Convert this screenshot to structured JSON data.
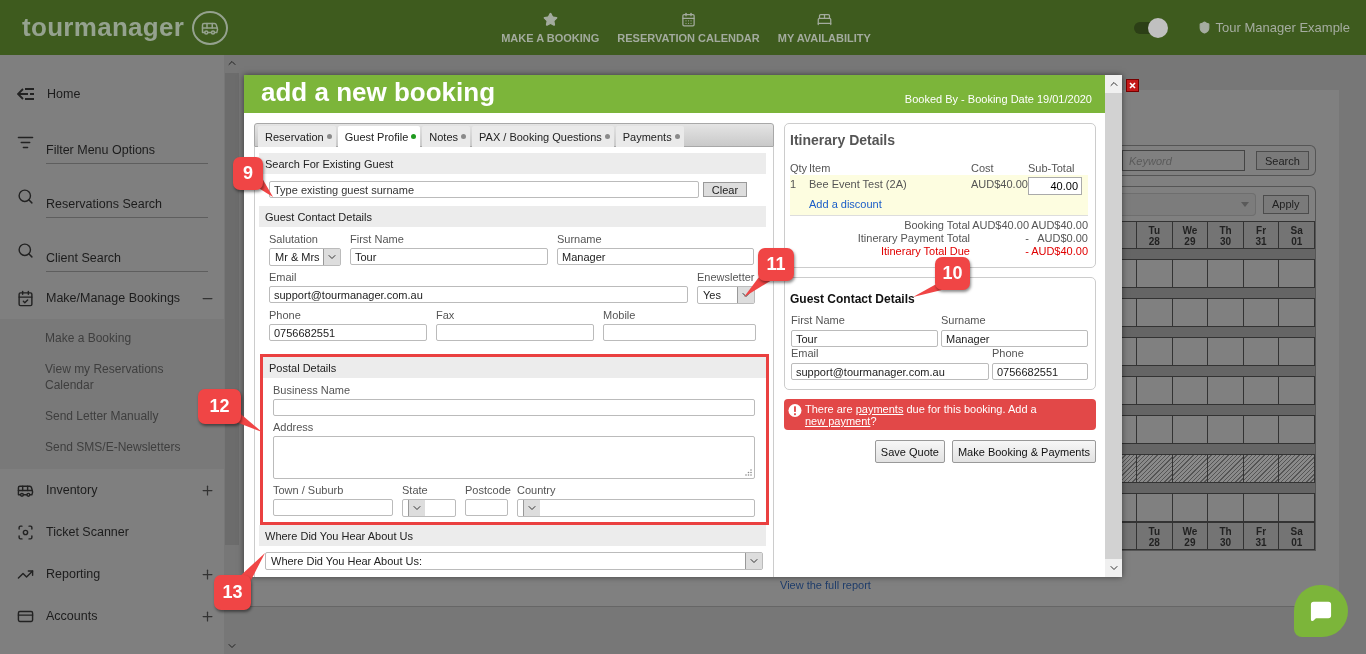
{
  "topbar": {
    "logo": "tourmanager",
    "nav": [
      {
        "label": "MAKE A BOOKING"
      },
      {
        "label": "RESERVATION CALENDAR"
      },
      {
        "label": "MY AVAILABILITY"
      }
    ],
    "toggle": {
      "on": true
    },
    "account": "Tour Manager Example"
  },
  "sidebar": {
    "items": [
      {
        "label": "Home",
        "kind": "link"
      },
      {
        "label": "Filter Menu Options",
        "kind": "field"
      },
      {
        "label": "Reservations Search",
        "kind": "field"
      },
      {
        "label": "Client Search",
        "kind": "field"
      },
      {
        "label": "Make/Manage Bookings",
        "kind": "link",
        "expanded": true,
        "children": [
          {
            "label": "Make a Booking"
          },
          {
            "label": "View my Reservations Calendar"
          },
          {
            "label": "Send Letter Manually"
          },
          {
            "label": "Send SMS/E-Newsletters"
          }
        ]
      },
      {
        "label": "Inventory",
        "kind": "link",
        "expanded": false
      },
      {
        "label": "Ticket Scanner",
        "kind": "link"
      },
      {
        "label": "Reporting",
        "kind": "link",
        "expanded": false
      },
      {
        "label": "Accounts",
        "kind": "link",
        "expanded": false
      }
    ]
  },
  "background": {
    "search": {
      "placeholder": "Keyword",
      "button": "Search"
    },
    "filter": {
      "button": "Apply"
    },
    "calendar": {
      "days": [
        {
          "day": "Tu",
          "date": "28"
        },
        {
          "day": "We",
          "date": "29"
        },
        {
          "day": "Th",
          "date": "30"
        },
        {
          "day": "Fr",
          "date": "31"
        },
        {
          "day": "Sa",
          "date": "01"
        }
      ],
      "footer_days": [
        {
          "day": "Tu",
          "date": "28"
        },
        {
          "day": "We",
          "date": "29"
        },
        {
          "day": "Th",
          "date": "30"
        },
        {
          "day": "Fr",
          "date": "31"
        },
        {
          "day": "Sa",
          "date": "01"
        }
      ],
      "rows": [
        {
          "hatched": false
        },
        {
          "hatched": false
        },
        {
          "hatched": false
        },
        {
          "hatched": false
        },
        {
          "hatched": false
        },
        {
          "hatched": true
        },
        {
          "hatched": false
        }
      ]
    },
    "report_link": "View the full report"
  },
  "modal": {
    "title": "add a new booking",
    "booked": "Booked By - Booking Date 19/01/2020",
    "tabs": [
      {
        "label": "Reservation",
        "selected": false,
        "color": "#8a8a8a"
      },
      {
        "label": "Guest Profile",
        "selected": true,
        "color": "#1f9a1f"
      },
      {
        "label": "Notes",
        "selected": false,
        "color": "#8a8a8a"
      },
      {
        "label": "PAX / Booking Questions",
        "selected": false,
        "color": "#8a8a8a"
      },
      {
        "label": "Payments",
        "selected": false,
        "color": "#8a8a8a"
      }
    ],
    "guest_search": {
      "heading": "Search For Existing Guest",
      "placeholder": "Type existing guest surname",
      "button": "Clear"
    },
    "contact": {
      "heading": "Guest Contact Details",
      "rows": [
        [
          {
            "label": "Salutation",
            "kind": "select",
            "value": "Mr & Mrs"
          },
          {
            "label": "First Name",
            "kind": "text",
            "value": "Tour"
          },
          {
            "label": "Surname",
            "kind": "text",
            "value": "Manager"
          }
        ],
        [
          {
            "label": "Email",
            "kind": "text",
            "value": "support@tourmanager.com.au"
          },
          {
            "label": "Enewsletter",
            "kind": "select",
            "value": "Yes"
          }
        ],
        [
          {
            "label": "Phone",
            "kind": "text",
            "value": "0756682551"
          },
          {
            "label": "Fax",
            "kind": "text"
          },
          {
            "label": "Mobile",
            "kind": "text"
          }
        ]
      ]
    },
    "postal": {
      "heading": "Postal Details",
      "highlighted": true,
      "rows": [
        [
          {
            "label": "Business Name",
            "kind": "text"
          }
        ],
        [
          {
            "label": "Address",
            "kind": "textarea"
          }
        ],
        [
          {
            "label": "Town / Suburb",
            "kind": "text"
          },
          {
            "label": "State",
            "kind": "select"
          },
          {
            "label": "Postcode",
            "kind": "text"
          },
          {
            "label": "Country",
            "kind": "select"
          }
        ]
      ]
    },
    "referral": {
      "heading": "Where Did You Hear About Us",
      "value": "Where Did You Hear About Us:"
    },
    "itinerary": {
      "title": "Itinerary Details",
      "columns": [
        "Qty",
        "Item",
        "Cost",
        "Sub-Total"
      ],
      "items": [
        {
          "qty": "1",
          "item": "Bee Event Test (2A)",
          "cost": "AUD$40.00",
          "subtotal": "40.00",
          "link": "Add a discount"
        }
      ],
      "totals": [
        {
          "label": "Booking Total",
          "col1": "AUD$40.00",
          "col2": "AUD$40.00",
          "kind": "normal"
        },
        {
          "label": "Itinerary Payment Total",
          "col1": "-",
          "col2": "AUD$0.00",
          "kind": "normal"
        },
        {
          "label": "Itinerary Total Due",
          "col1": "-",
          "col2": "AUD$40.00",
          "kind": "due"
        }
      ]
    },
    "guest_summary": {
      "heading": "Guest Contact Details",
      "fields": [
        {
          "label": "First Name",
          "value": "Tour"
        },
        {
          "label": "Surname",
          "value": "Manager"
        },
        {
          "label": "Email",
          "value": "support@tourmanager.com.au"
        },
        {
          "label": "Phone",
          "value": "0756682551"
        }
      ]
    },
    "alert": {
      "parts": [
        {
          "text": "There are "
        },
        {
          "text": "payments",
          "link": true
        },
        {
          "text": " due for this booking. Add a "
        },
        {
          "text": "new payment",
          "link": true
        },
        {
          "text": "?"
        }
      ]
    },
    "buttons": [
      "Save Quote",
      "Make Booking & Payments"
    ]
  },
  "callouts": [
    {
      "label": "9"
    },
    {
      "label": "10"
    },
    {
      "label": "11"
    },
    {
      "label": "12"
    },
    {
      "label": "13"
    }
  ]
}
